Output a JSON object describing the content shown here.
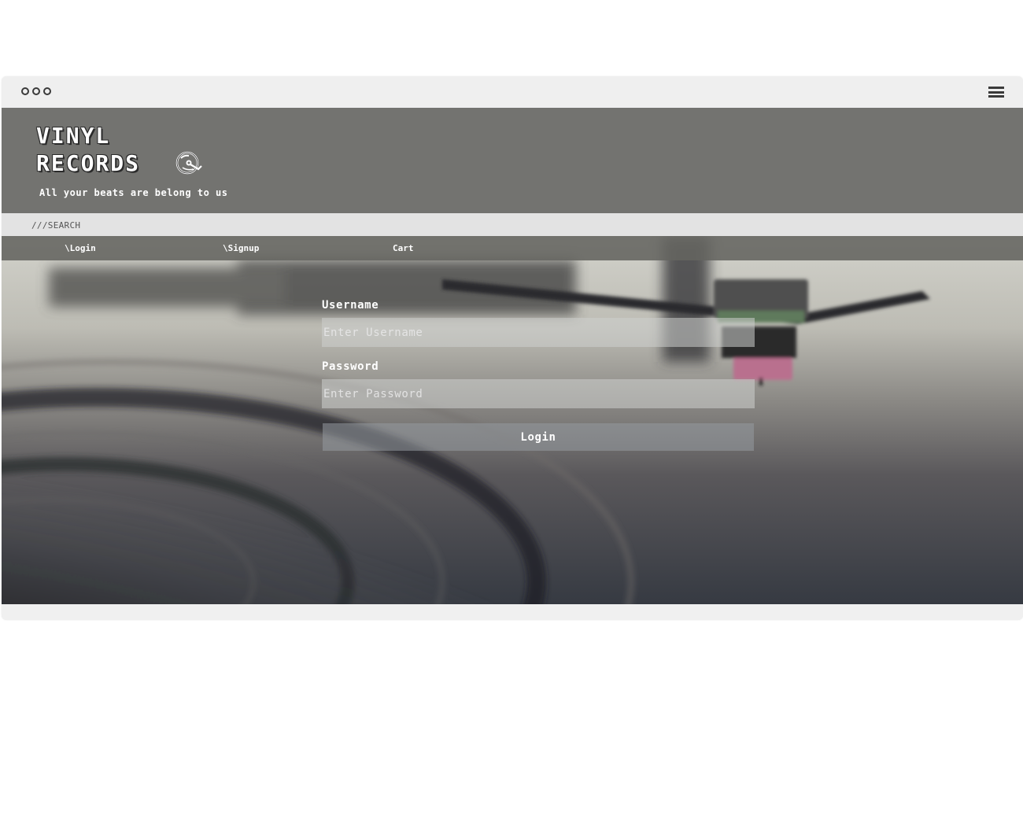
{
  "header": {
    "logo_line1": "VINYL",
    "logo_line2": "RECORDS",
    "tagline": "All your beats are belong to us"
  },
  "search": {
    "label": "///SEARCH"
  },
  "nav": {
    "items": [
      {
        "label": "\\Login"
      },
      {
        "label": "\\Signup"
      },
      {
        "label": "Cart"
      }
    ]
  },
  "form": {
    "username_label": "Username",
    "username_placeholder": "Enter Username",
    "password_label": "Password",
    "password_placeholder": "Enter Password",
    "login_button": "Login"
  },
  "colors": {
    "header_bg": "#737370",
    "search_bg": "#e3e3e3",
    "nav_bg": "#646460"
  },
  "icons": [
    "window-dots-icon",
    "hamburger-menu-icon",
    "vinyl-record-icon"
  ]
}
